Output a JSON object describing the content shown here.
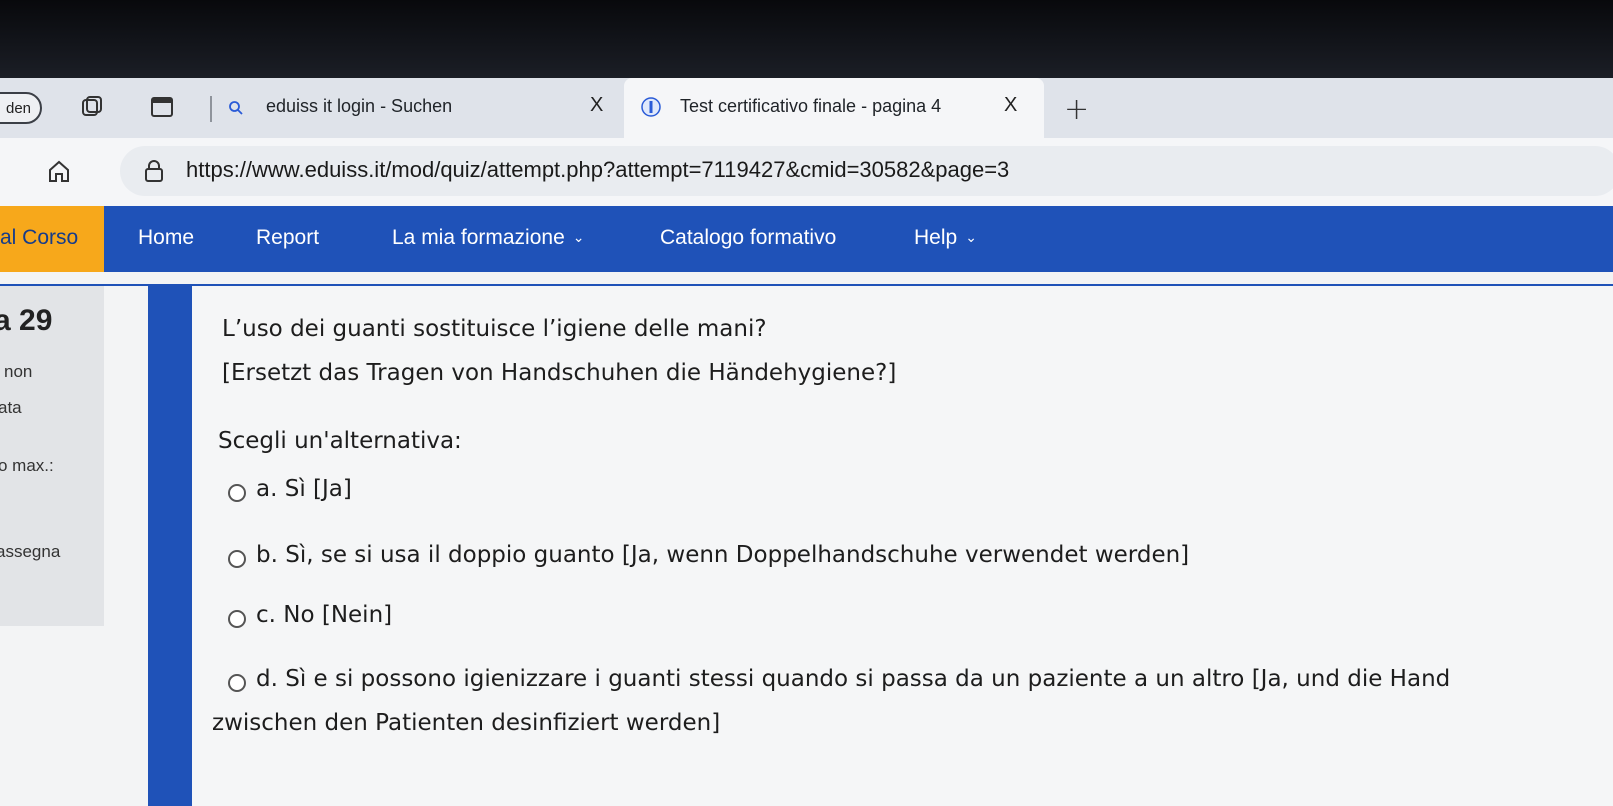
{
  "browser": {
    "profile_label": "den",
    "tabs": [
      {
        "label": "eduiss it login - Suchen",
        "close": "X"
      },
      {
        "label": "Test certificativo finale - pagina 4",
        "close": "X"
      }
    ],
    "new_tab": "+",
    "url": "https://www.eduiss.it/mod/quiz/attempt.php?attempt=7119427&cmid=30582&page=3"
  },
  "navbar": {
    "items": [
      "al Corso",
      "Home",
      "Report",
      "La mia formazione",
      "Catalogo formativo",
      "Help"
    ],
    "chevron": "⌄"
  },
  "question_info": {
    "number": "a 29",
    "line1": "non",
    "line2": "ata",
    "line3": "o max.:",
    "line4": "assegna"
  },
  "question": {
    "text_it": "L’uso dei guanti sostituisce l’igiene delle mani?",
    "text_de": "[Ersetzt das Tragen von Handschuhen die Händehygiene?]",
    "prompt": "Scegli un'alternativa:",
    "options": [
      {
        "label": "a. Sì [Ja]"
      },
      {
        "label": "b. Sì, se si usa il doppio guanto [Ja, wenn Doppelhandschuhe verwendet werden]"
      },
      {
        "label": "c. No [Nein]"
      },
      {
        "label": "d. Sì e si possono igienizzare i guanti stessi quando si passa da un paziente a un altro [Ja, und die Hand"
      }
    ],
    "option_d_wrap": "zwischen den Patienten desinfiziert werden]"
  },
  "colors": {
    "nav_blue": "#1f52b8",
    "nav_active": "#f7a81b"
  }
}
